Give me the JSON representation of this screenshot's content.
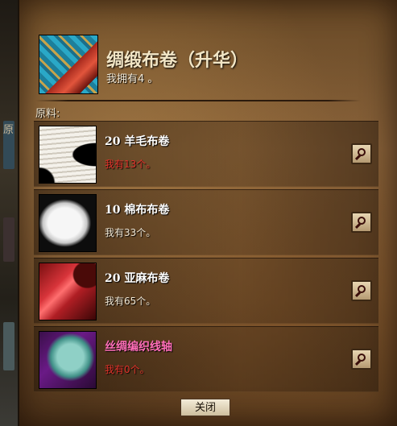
{
  "backdrop": {
    "partial_text": "原"
  },
  "header": {
    "title": "绸缎布卷（升华）",
    "owned": "我拥有4 。"
  },
  "materials_label": "原料:",
  "materials": [
    {
      "name": "20 羊毛布卷",
      "have": "我有13个。",
      "sufficient": false,
      "icon": "wool-bolt-icon"
    },
    {
      "name": "10 棉布布卷",
      "have": "我有33个。",
      "sufficient": true,
      "icon": "cotton-bolt-icon"
    },
    {
      "name": "20 亚麻布卷",
      "have": "我有65个。",
      "sufficient": true,
      "icon": "linen-bolt-icon"
    },
    {
      "name": "丝绸编织线轴",
      "have": "我有0个。",
      "sufficient": false,
      "icon": "silk-spool-icon"
    }
  ],
  "close_label": "关闭",
  "colors": {
    "insufficient": "#e0322a",
    "special_item": "#ff6eb8",
    "text_light": "#f2e6c6"
  }
}
